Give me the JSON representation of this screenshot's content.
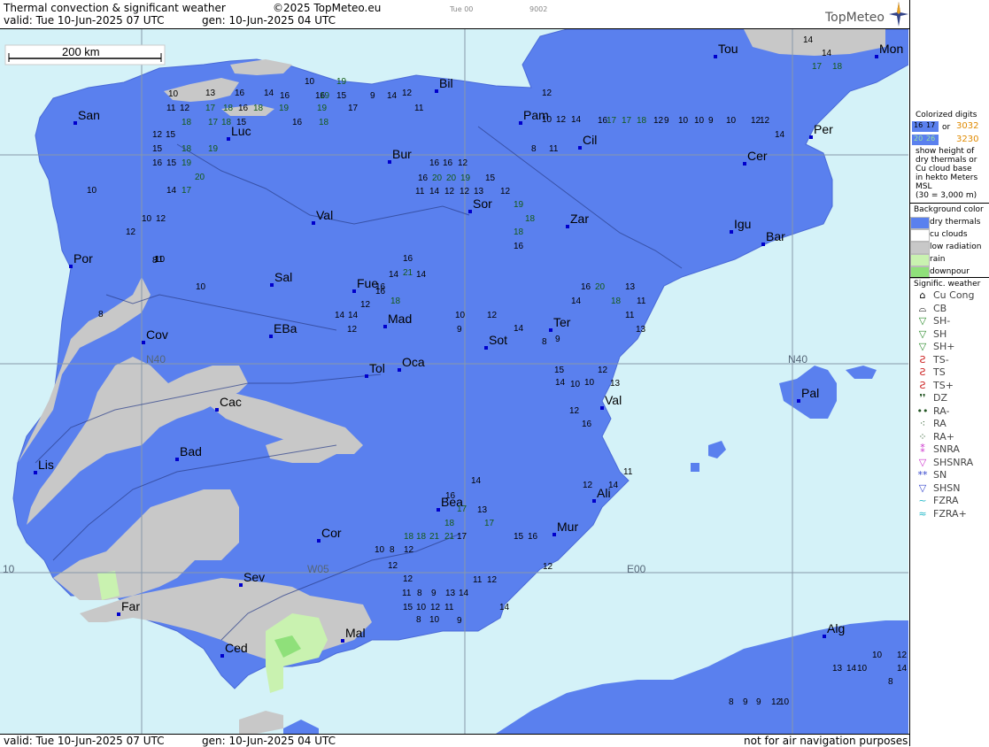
{
  "header": {
    "line1_title": "Thermal convection & significant weather",
    "line1_copyright": "©2025 TopMeteo.eu",
    "line1_run": "Tue 00",
    "line1_code": "9002",
    "line2_valid": "valid:  Tue  10-Jun-2025  07 UTC",
    "line2_gen": "gen: 10-Jun-2025 04 UTC",
    "logo": "TopMeteo"
  },
  "footer": {
    "valid": "valid:  Tue  10-Jun-2025  07 UTC",
    "gen": "gen: 10-Jun-2025 04 UTC",
    "disclaimer": "not for air navigation purposes"
  },
  "scale_bar": {
    "label": "200 km"
  },
  "grid_labels": {
    "n40_left": "N40",
    "n40_right": "N40",
    "w05": "W05",
    "e00": "E00",
    "w10": "10"
  },
  "colors": {
    "sea": "#d4f2f8",
    "dry_thermals": "#5a80ee",
    "low_radiation": "#c8c8c8",
    "rain": "#c9f2b0",
    "downpour": "#8fe07a",
    "city": "#0000cc"
  },
  "cities": [
    {
      "name": "San"
    },
    {
      "name": "Bil"
    },
    {
      "name": "Tou"
    },
    {
      "name": "Mon"
    },
    {
      "name": "Luc"
    },
    {
      "name": "Pam"
    },
    {
      "name": "Cil"
    },
    {
      "name": "Per"
    },
    {
      "name": "Bur"
    },
    {
      "name": "Cer"
    },
    {
      "name": "Sor"
    },
    {
      "name": "Val"
    },
    {
      "name": "Zar"
    },
    {
      "name": "Igu"
    },
    {
      "name": "Bar"
    },
    {
      "name": "Por"
    },
    {
      "name": "Sal"
    },
    {
      "name": "Fue"
    },
    {
      "name": "Mad"
    },
    {
      "name": "Cov"
    },
    {
      "name": "EBa"
    },
    {
      "name": "Ter"
    },
    {
      "name": "Sot"
    },
    {
      "name": "Tol"
    },
    {
      "name": "Oca"
    },
    {
      "name": "Pal"
    },
    {
      "name": "Cac"
    },
    {
      "name": "Val"
    },
    {
      "name": "Bad"
    },
    {
      "name": "Lis"
    },
    {
      "name": "Ali"
    },
    {
      "name": "Bea"
    },
    {
      "name": "Mur"
    },
    {
      "name": "Cor"
    },
    {
      "name": "Sev"
    },
    {
      "name": "Far"
    },
    {
      "name": "Mal"
    },
    {
      "name": "Ced"
    },
    {
      "name": "Alg"
    }
  ],
  "digits": [
    {
      "v": "10",
      "c": "k"
    },
    {
      "v": "13",
      "c": "k"
    },
    {
      "v": "16",
      "c": "k"
    },
    {
      "v": "14",
      "c": "k"
    },
    {
      "v": "16",
      "c": "k"
    },
    {
      "v": "10",
      "c": "k"
    },
    {
      "v": "16",
      "c": "k"
    },
    {
      "v": "19",
      "c": "g"
    },
    {
      "v": "15",
      "c": "k"
    },
    {
      "v": "19",
      "c": "g"
    },
    {
      "v": "9",
      "c": "k"
    },
    {
      "v": "14",
      "c": "k"
    },
    {
      "v": "12",
      "c": "k"
    },
    {
      "v": "11",
      "c": "k"
    },
    {
      "v": "12",
      "c": "k"
    },
    {
      "v": "17",
      "c": "g"
    },
    {
      "v": "18",
      "c": "g"
    },
    {
      "v": "16",
      "c": "k"
    },
    {
      "v": "18",
      "c": "g"
    },
    {
      "v": "19",
      "c": "g"
    },
    {
      "v": "19",
      "c": "g"
    },
    {
      "v": "17",
      "c": "k"
    },
    {
      "v": "11",
      "c": "k"
    },
    {
      "v": "18",
      "c": "g"
    },
    {
      "v": "17",
      "c": "g"
    },
    {
      "v": "18",
      "c": "g"
    },
    {
      "v": "15",
      "c": "k"
    },
    {
      "v": "16",
      "c": "k"
    },
    {
      "v": "18",
      "c": "g"
    },
    {
      "v": "12",
      "c": "k"
    },
    {
      "v": "15",
      "c": "k"
    },
    {
      "v": "15",
      "c": "k"
    },
    {
      "v": "18",
      "c": "g"
    },
    {
      "v": "19",
      "c": "g"
    },
    {
      "v": "16",
      "c": "k"
    },
    {
      "v": "15",
      "c": "k"
    },
    {
      "v": "19",
      "c": "g"
    },
    {
      "v": "20",
      "c": "g"
    },
    {
      "v": "14",
      "c": "k"
    },
    {
      "v": "17",
      "c": "g"
    },
    {
      "v": "10",
      "c": "k"
    },
    {
      "v": "12",
      "c": "k"
    },
    {
      "v": "10",
      "c": "k"
    },
    {
      "v": "12",
      "c": "k"
    },
    {
      "v": "10",
      "c": "k"
    },
    {
      "v": "11",
      "c": "k"
    },
    {
      "v": "10",
      "c": "k"
    },
    {
      "v": "8",
      "c": "k"
    },
    {
      "v": "8",
      "c": "k"
    },
    {
      "v": "8",
      "c": "k"
    },
    {
      "v": "11",
      "c": "k"
    },
    {
      "v": "12",
      "c": "k"
    },
    {
      "v": "10",
      "c": "k"
    },
    {
      "v": "12",
      "c": "k"
    },
    {
      "v": "14",
      "c": "k"
    },
    {
      "v": "16",
      "c": "k"
    },
    {
      "v": "17",
      "c": "g"
    },
    {
      "v": "17",
      "c": "g"
    },
    {
      "v": "18",
      "c": "g"
    },
    {
      "v": "12",
      "c": "k"
    },
    {
      "v": "9",
      "c": "k"
    },
    {
      "v": "10",
      "c": "k"
    },
    {
      "v": "10",
      "c": "k"
    },
    {
      "v": "9",
      "c": "k"
    },
    {
      "v": "10",
      "c": "k"
    },
    {
      "v": "12",
      "c": "k"
    },
    {
      "v": "12",
      "c": "k"
    },
    {
      "v": "14",
      "c": "k"
    },
    {
      "v": "14",
      "c": "k"
    },
    {
      "v": "14",
      "c": "k"
    },
    {
      "v": "17",
      "c": "g"
    },
    {
      "v": "18",
      "c": "g"
    },
    {
      "v": "16",
      "c": "k"
    },
    {
      "v": "16",
      "c": "k"
    },
    {
      "v": "12",
      "c": "k"
    },
    {
      "v": "16",
      "c": "k"
    },
    {
      "v": "20",
      "c": "g"
    },
    {
      "v": "20",
      "c": "g"
    },
    {
      "v": "19",
      "c": "g"
    },
    {
      "v": "15",
      "c": "k"
    },
    {
      "v": "11",
      "c": "k"
    },
    {
      "v": "14",
      "c": "k"
    },
    {
      "v": "12",
      "c": "k"
    },
    {
      "v": "12",
      "c": "k"
    },
    {
      "v": "13",
      "c": "k"
    },
    {
      "v": "12",
      "c": "k"
    },
    {
      "v": "19",
      "c": "g"
    },
    {
      "v": "18",
      "c": "g"
    },
    {
      "v": "18",
      "c": "g"
    },
    {
      "v": "16",
      "c": "k"
    },
    {
      "v": "16",
      "c": "k"
    },
    {
      "v": "16",
      "c": "k"
    },
    {
      "v": "21",
      "c": "g"
    },
    {
      "v": "14",
      "c": "k"
    },
    {
      "v": "14",
      "c": "k"
    },
    {
      "v": "16",
      "c": "k"
    },
    {
      "v": "12",
      "c": "k"
    },
    {
      "v": "14",
      "c": "k"
    },
    {
      "v": "14",
      "c": "k"
    },
    {
      "v": "12",
      "c": "k"
    },
    {
      "v": "18",
      "c": "g"
    },
    {
      "v": "10",
      "c": "k"
    },
    {
      "v": "12",
      "c": "k"
    },
    {
      "v": "9",
      "c": "k"
    },
    {
      "v": "14",
      "c": "k"
    },
    {
      "v": "8",
      "c": "k"
    },
    {
      "v": "9",
      "c": "k"
    },
    {
      "v": "14",
      "c": "k"
    },
    {
      "v": "16",
      "c": "k"
    },
    {
      "v": "20",
      "c": "g"
    },
    {
      "v": "18",
      "c": "g"
    },
    {
      "v": "13",
      "c": "k"
    },
    {
      "v": "11",
      "c": "k"
    },
    {
      "v": "11",
      "c": "k"
    },
    {
      "v": "13",
      "c": "k"
    },
    {
      "v": "15",
      "c": "k"
    },
    {
      "v": "14",
      "c": "k"
    },
    {
      "v": "10",
      "c": "k"
    },
    {
      "v": "10",
      "c": "k"
    },
    {
      "v": "12",
      "c": "k"
    },
    {
      "v": "13",
      "c": "k"
    },
    {
      "v": "12",
      "c": "k"
    },
    {
      "v": "16",
      "c": "k"
    },
    {
      "v": "12",
      "c": "k"
    },
    {
      "v": "14",
      "c": "k"
    },
    {
      "v": "11",
      "c": "k"
    },
    {
      "v": "14",
      "c": "k"
    },
    {
      "v": "16",
      "c": "k"
    },
    {
      "v": "13",
      "c": "k"
    },
    {
      "v": "17",
      "c": "g"
    },
    {
      "v": "18",
      "c": "g"
    },
    {
      "v": "17",
      "c": "g"
    },
    {
      "v": "21",
      "c": "g"
    },
    {
      "v": "18",
      "c": "g"
    },
    {
      "v": "21",
      "c": "g"
    },
    {
      "v": "18",
      "c": "g"
    },
    {
      "v": "17",
      "c": "k"
    },
    {
      "v": "12",
      "c": "k"
    },
    {
      "v": "8",
      "c": "k"
    },
    {
      "v": "12",
      "c": "k"
    },
    {
      "v": "10",
      "c": "k"
    },
    {
      "v": "12",
      "c": "k"
    },
    {
      "v": "11",
      "c": "k"
    },
    {
      "v": "8",
      "c": "k"
    },
    {
      "v": "9",
      "c": "k"
    },
    {
      "v": "13",
      "c": "k"
    },
    {
      "v": "14",
      "c": "k"
    },
    {
      "v": "15",
      "c": "k"
    },
    {
      "v": "10",
      "c": "k"
    },
    {
      "v": "12",
      "c": "k"
    },
    {
      "v": "11",
      "c": "k"
    },
    {
      "v": "9",
      "c": "k"
    },
    {
      "v": "8",
      "c": "k"
    },
    {
      "v": "10",
      "c": "k"
    },
    {
      "v": "11",
      "c": "k"
    },
    {
      "v": "12",
      "c": "k"
    },
    {
      "v": "14",
      "c": "k"
    },
    {
      "v": "15",
      "c": "k"
    },
    {
      "v": "16",
      "c": "k"
    },
    {
      "v": "12",
      "c": "k"
    },
    {
      "v": "13",
      "c": "k"
    },
    {
      "v": "14",
      "c": "k"
    },
    {
      "v": "10",
      "c": "k"
    },
    {
      "v": "10",
      "c": "k"
    },
    {
      "v": "12",
      "c": "k"
    },
    {
      "v": "14",
      "c": "k"
    },
    {
      "v": "8",
      "c": "k"
    },
    {
      "v": "8",
      "c": "k"
    },
    {
      "v": "9",
      "c": "k"
    },
    {
      "v": "9",
      "c": "k"
    },
    {
      "v": "12",
      "c": "k"
    },
    {
      "v": "10",
      "c": "k"
    }
  ],
  "legend": {
    "colorized_title": "Colorized digits",
    "sample_a_blue1": "16",
    "sample_a_blue2": "17",
    "sample_or": "or",
    "sample_orange1": "3032",
    "sample_b_green1": "20",
    "sample_b_green2": "26",
    "sample_orange2": "3230",
    "desc_lines": [
      "show height of",
      "dry thermals or",
      "Cu cloud base",
      "in hekto Meters",
      "MSL",
      "(30 = 3,000 m)"
    ],
    "bg_title": "Background color",
    "bg_items": [
      {
        "label": "dry thermals",
        "color": "#5a80ee"
      },
      {
        "label": "cu clouds",
        "color": "#ffffff"
      },
      {
        "label": "low radiation",
        "color": "#c8c8c8"
      },
      {
        "label": "rain",
        "color": "#c9f2b0"
      },
      {
        "label": "downpour",
        "color": "#8fe07a"
      }
    ],
    "wx_title": "Signific. weather",
    "wx_items": [
      {
        "sym": "⌂",
        "label": "Cu Cong",
        "color": "#000"
      },
      {
        "sym": "⌓",
        "label": "CB",
        "color": "#000"
      },
      {
        "sym": "▽",
        "label": "SH-",
        "color": "#2a8a2a"
      },
      {
        "sym": "▽",
        "label": "SH",
        "color": "#2a8a2a"
      },
      {
        "sym": "▽",
        "label": "SH+",
        "color": "#2a8a2a"
      },
      {
        "sym": "Ƨ",
        "label": "TS-",
        "color": "#cc2222"
      },
      {
        "sym": "Ƨ",
        "label": "TS",
        "color": "#cc2222"
      },
      {
        "sym": "Ƨ",
        "label": "TS+",
        "color": "#cc2222"
      },
      {
        "sym": "❜❜",
        "label": "DZ",
        "color": "#225522"
      },
      {
        "sym": "••",
        "label": "RA-",
        "color": "#225522"
      },
      {
        "sym": "⁖",
        "label": "RA",
        "color": "#225522"
      },
      {
        "sym": "⁘",
        "label": "RA+",
        "color": "#225522"
      },
      {
        "sym": "⁑",
        "label": "SNRA",
        "color": "#cc33cc"
      },
      {
        "sym": "▽",
        "label": "SHSNRA",
        "color": "#cc33cc"
      },
      {
        "sym": "**",
        "label": "SN",
        "color": "#3344cc"
      },
      {
        "sym": "▽",
        "label": "SHSN",
        "color": "#3344cc"
      },
      {
        "sym": "~",
        "label": "FZRA",
        "color": "#22b8c8"
      },
      {
        "sym": "≈",
        "label": "FZRA+",
        "color": "#22b8c8"
      }
    ]
  }
}
